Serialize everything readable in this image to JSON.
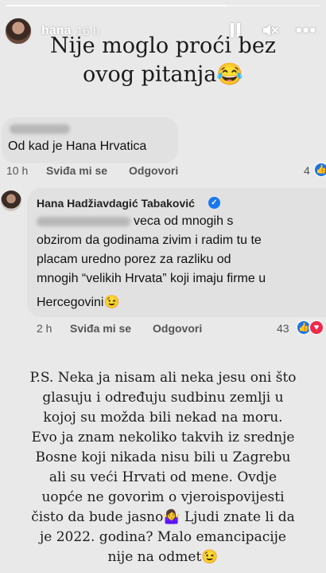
{
  "story": {
    "username": "hana",
    "time_ago": "16 h",
    "progress": 0.7,
    "icons": {
      "pause": "pause-icon",
      "mute": "mute-icon",
      "more": "more-icon"
    },
    "more_label": "•••"
  },
  "caption_top": {
    "line1": "Nije moglo proći bez",
    "line2": "ovog pitanja😂"
  },
  "comment1": {
    "text": "Od kad je Hana Hrvatica",
    "time": "10 h",
    "like_label": "Sviđa mi se",
    "reply_label": "Odgovori",
    "reaction_count": "4"
  },
  "comment2": {
    "author": "Hana Hadžiavdagić Tabaković",
    "line1": "veca od mnogih s",
    "line2": "obzirom da godinama zivim i radim tu te",
    "line3": "placam uredno porez za razliku od",
    "line4": "mnogih “velikih Hrvata” koji imaju firme u",
    "line5": "Hercegovini😉",
    "time": "2 h",
    "like_label": "Sviđa mi se",
    "reply_label": "Odgovori",
    "reaction_count": "43"
  },
  "caption_bottom": {
    "lines": [
      "P.S. Neka ja nisam ali neka jesu oni što",
      "glasuju i određuju sudbinu zemlji u",
      "kojoj su možda bili nekad na moru.",
      "Evo ja znam nekoliko takvih iz srednje",
      "Bosne koji nikada nisu bili u Zagrebu",
      "ali su veći Hrvati od mene. Ovdje",
      "uopće ne govorim o vjeroispovijesti",
      "čisto da bude jasno🤷‍♀️ Ljudi znate li da",
      "je 2022. godina? Malo emancipacije",
      "nije na odmet😉"
    ]
  },
  "colors": {
    "background": "#e9e9e9",
    "bubble": "#e1e1e1",
    "like_blue": "#1a73e8",
    "love_red": "#f02849",
    "verified_blue": "#1877f2"
  }
}
